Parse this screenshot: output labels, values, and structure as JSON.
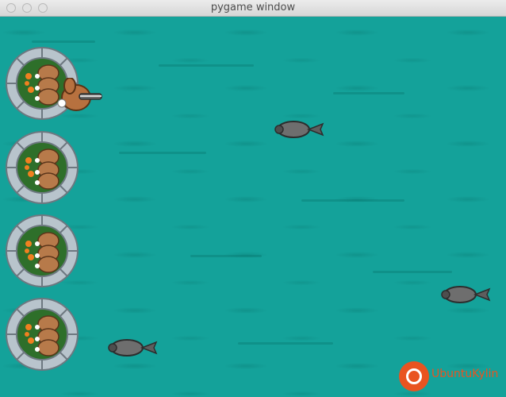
{
  "window": {
    "title": "pygame window"
  },
  "scene": {
    "background_color": "#14a29a",
    "turrets": [
      {
        "kind": "stone-turret-with-rabbits"
      },
      {
        "kind": "stone-turret-with-rabbits"
      },
      {
        "kind": "stone-turret-with-rabbits"
      },
      {
        "kind": "stone-turret-with-rabbits"
      }
    ],
    "player": {
      "kind": "rabbit-with-crossbow"
    },
    "enemies": [
      {
        "kind": "grey-badger"
      },
      {
        "kind": "grey-badger"
      },
      {
        "kind": "grey-badger"
      }
    ]
  },
  "watermark": {
    "text": "UbuntuKylin",
    "color": "#e95420"
  }
}
